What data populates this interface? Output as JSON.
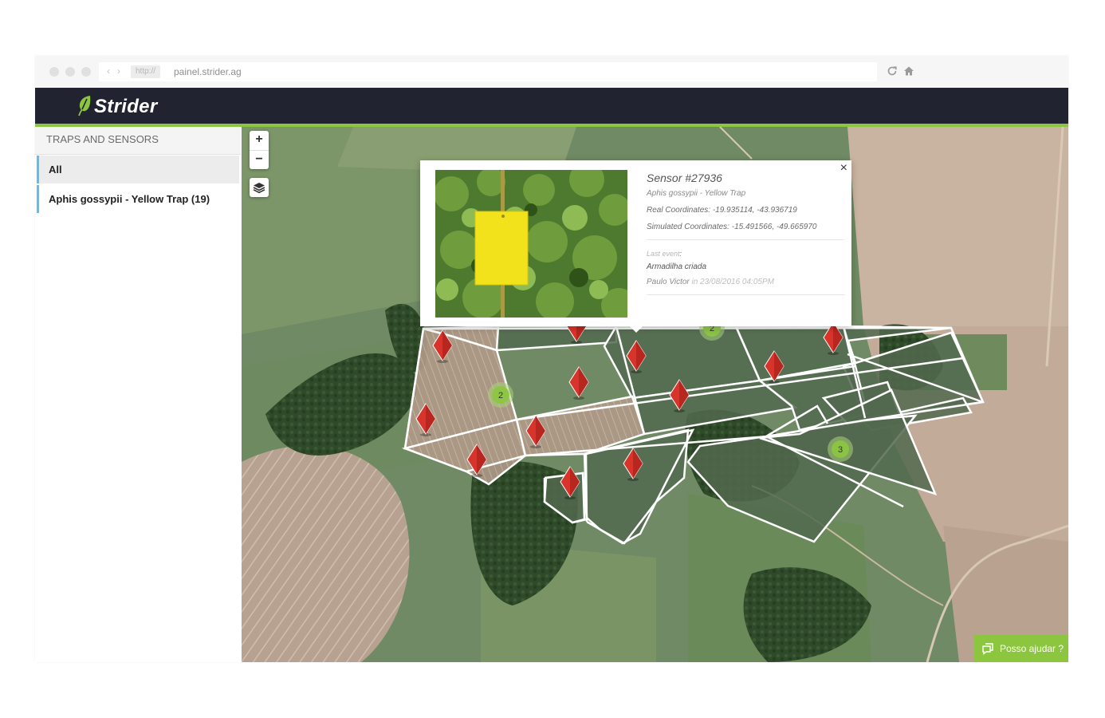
{
  "browser": {
    "protocol": "http://",
    "url": "painel.strider.ag",
    "back_icon": "chevron-left-icon",
    "forward_icon": "chevron-right-icon",
    "reload_icon": "reload-icon",
    "home_icon": "home-icon"
  },
  "app": {
    "logo_text": "Strider",
    "brand_color": "#8cc63f",
    "header_color": "#212331"
  },
  "sidebar": {
    "title": "TRAPS AND SENSORS",
    "items": [
      {
        "label": "All",
        "selected": true
      },
      {
        "label": "Aphis gossypii - Yellow Trap (19)",
        "selected": false
      }
    ]
  },
  "map": {
    "zoom_in": "+",
    "zoom_out": "−",
    "layers_icon": "layers-icon",
    "marker_color": "#d9342b",
    "cluster_color": "#a9d27a",
    "clusters": [
      {
        "count": "2"
      },
      {
        "count": "2"
      },
      {
        "count": "3"
      }
    ]
  },
  "popup": {
    "close": "×",
    "title": "Sensor #27936",
    "subtitle": "Aphis gossypii - Yellow Trap",
    "real_label": "Real Coordinates:",
    "real_value": "-19.935114, -43.936719",
    "sim_label": "Simulated Coordinates:",
    "sim_value": "-15.491566, -49.665970",
    "last_event_label": "Last event",
    "last_event_colon": ":",
    "event": "Armadilha criada",
    "user": "Paulo Victor",
    "in_word": "in",
    "datetime": "23/08/2016 04:05PM"
  },
  "help": {
    "label": "Posso ajudar ?",
    "icon": "chat-icon"
  }
}
